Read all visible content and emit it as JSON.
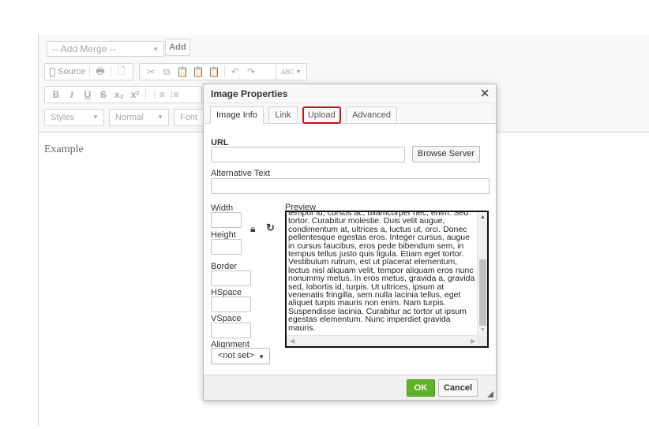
{
  "toolbar": {
    "merge_placeholder": "-- Add Merge --",
    "add_label": "Add",
    "source_label": "Source",
    "styles_label": "Styles",
    "format_label": "Normal",
    "font_label": "Font",
    "spell_label": "ABC"
  },
  "editor": {
    "content": "Example"
  },
  "dialog": {
    "title": "Image Properties",
    "tabs": [
      {
        "label": "Image Info",
        "active": true
      },
      {
        "label": "Link",
        "active": false
      },
      {
        "label": "Upload",
        "active": false,
        "highlighted": true
      },
      {
        "label": "Advanced",
        "active": false
      }
    ],
    "url_label": "URL",
    "browse_label": "Browse Server",
    "alt_label": "Alternative Text",
    "width_label": "Width",
    "height_label": "Height",
    "border_label": "Border",
    "hspace_label": "HSpace",
    "vspace_label": "VSpace",
    "alignment_label": "Alignment",
    "alignment_value": "<not set>",
    "preview_label": "Preview",
    "preview_text": "tempor id, cursus ac, ullamcorper nec, enim. Sed tortor. Curabitur molestie. Duis velit augue, condimentum at, ultrices a, luctus ut, orci. Donec pellentesque egestas eros. Integer cursus, augue in cursus faucibus, eros pede bibendum sem, in tempus tellus justo quis ligula. Etiam eget tortor. Vestibulum rutrum, est ut placerat elementum, lectus nisl aliquam velit, tempor aliquam eros nunc nonummy metus. In eros metus, gravida a, gravida sed, lobortis id, turpis. Ut ultrices, ipsum at venenatis fringilla, sem nulla lacinia tellus, eget aliquet turpis mauris non enim. Nam turpis. Suspendisse lacinia. Curabitur ac tortor ut ipsum egestas elementum. Nunc imperdiet gravida mauris.",
    "ok_label": "OK",
    "cancel_label": "Cancel"
  },
  "colors": {
    "ok_green": "#5fb224",
    "highlight_red": "#d0101a"
  }
}
